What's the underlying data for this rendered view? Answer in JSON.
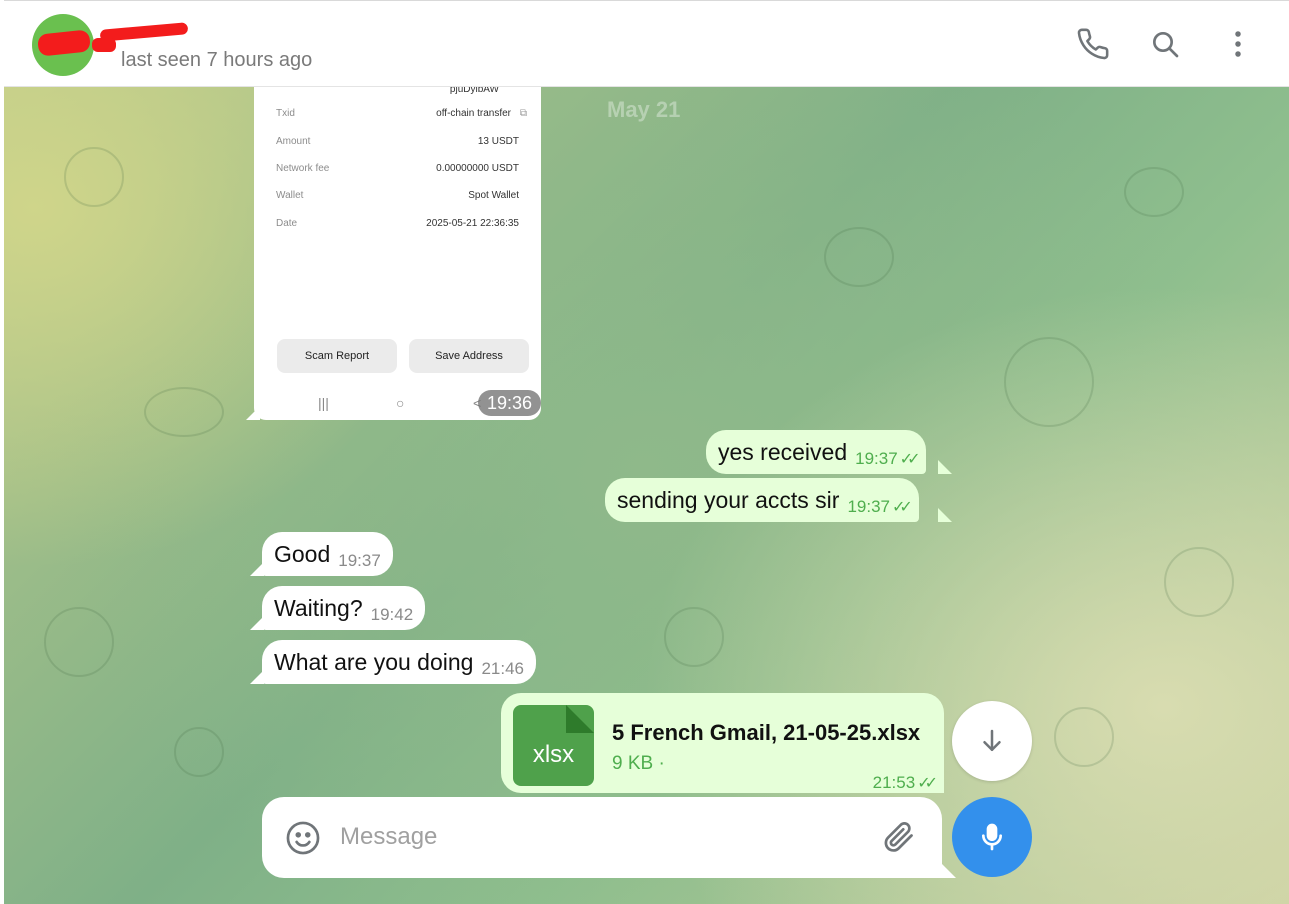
{
  "header": {
    "status": "last seen 7 hours ago",
    "icons": [
      "phone-icon",
      "search-icon",
      "more-vertical-icon"
    ]
  },
  "date_separator": "May 21",
  "screenshot_message": {
    "top_text": "pjuDyibAW",
    "rows": [
      {
        "key": "Txid",
        "value": "off-chain transfer"
      },
      {
        "key": "Amount",
        "value": "13 USDT"
      },
      {
        "key": "Network fee",
        "value": "0.00000000 USDT"
      },
      {
        "key": "Wallet",
        "value": "Spot Wallet"
      },
      {
        "key": "Date",
        "value": "2025-05-21 22:36:35"
      }
    ],
    "buttons": {
      "scam_report": "Scam Report",
      "save_address": "Save Address"
    },
    "nav": {
      "recent": "|||",
      "home": "○",
      "back": "<"
    },
    "time": "19:36"
  },
  "messages": [
    {
      "direction": "out",
      "text": "yes received",
      "time": "19:37",
      "status": "read"
    },
    {
      "direction": "out",
      "text": "sending your accts sir",
      "time": "19:37",
      "status": "read"
    },
    {
      "direction": "in",
      "text": "Good",
      "time": "19:37"
    },
    {
      "direction": "in",
      "text": "Waiting?",
      "time": "19:42"
    },
    {
      "direction": "in",
      "text": "What are you doing",
      "time": "21:46"
    }
  ],
  "file_message": {
    "extension": "xlsx",
    "filename": "5 French Gmail, 21-05-25.xlsx",
    "size": "9 KB ·",
    "time": "21:53",
    "status": "read"
  },
  "composer": {
    "placeholder": "Message"
  },
  "colors": {
    "accent": "#3390ec",
    "outgoing_bubble": "#e6ffd9",
    "read_ticks": "#4fae4e",
    "file_icon": "#4fa14b"
  }
}
